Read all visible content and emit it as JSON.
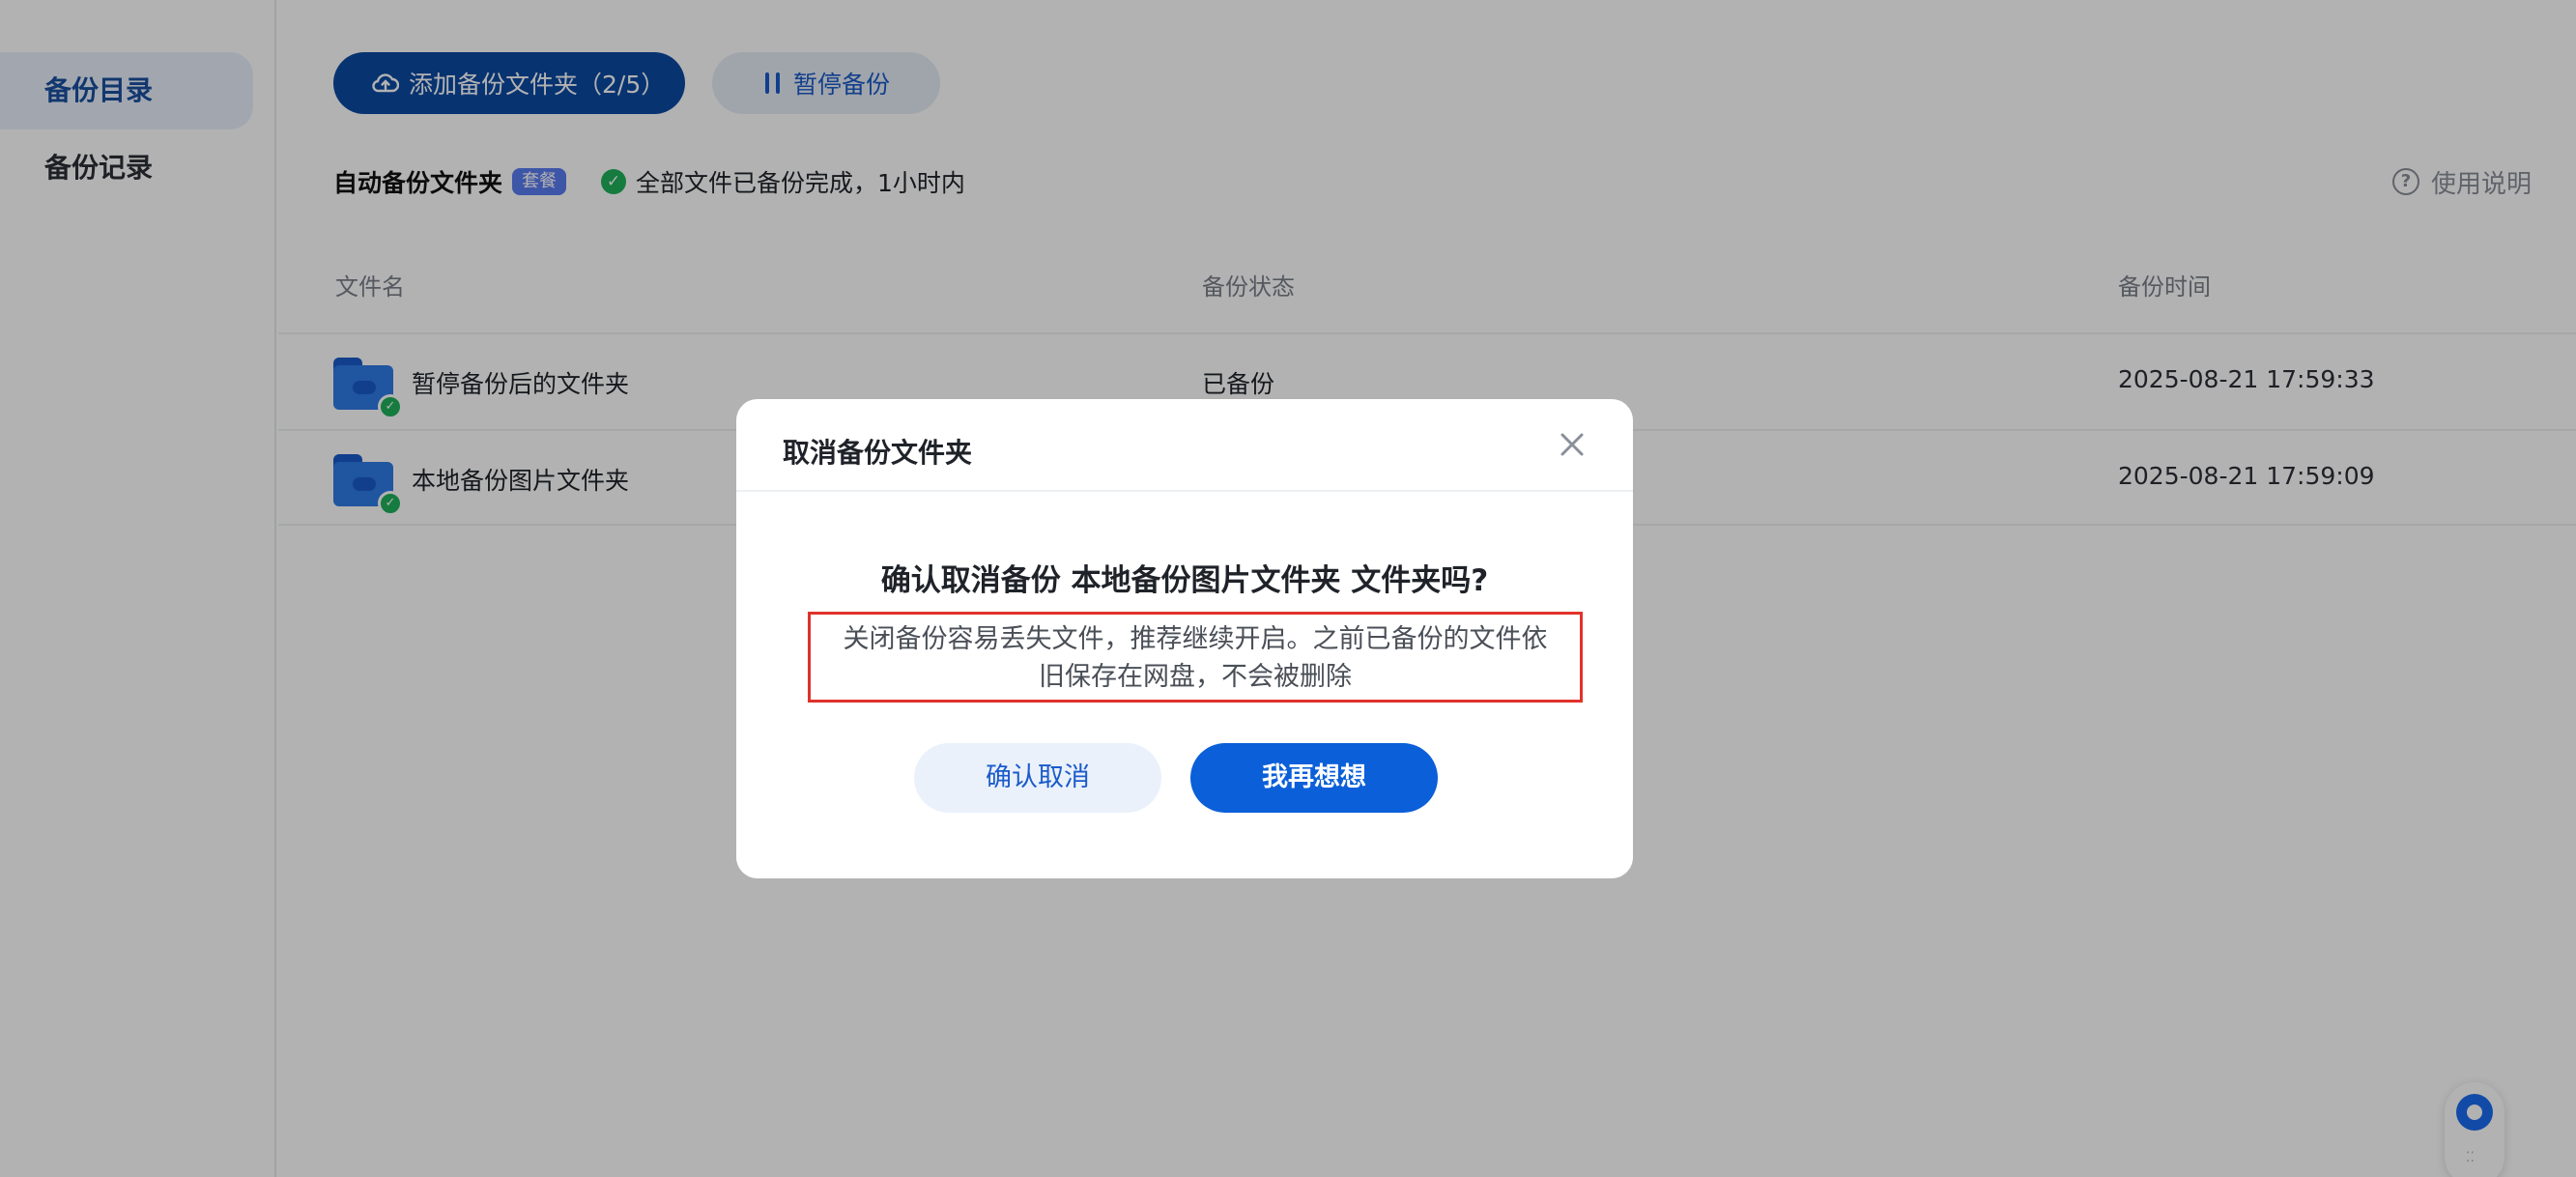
{
  "sidebar": {
    "items": [
      {
        "label": "备份目录",
        "active": true
      },
      {
        "label": "备份记录",
        "active": false
      }
    ]
  },
  "toolbar": {
    "add_label": "添加备份文件夹（2/5）",
    "pause_label": "暂停备份"
  },
  "auto": {
    "title": "自动备份文件夹",
    "badge": "套餐",
    "status": "全部文件已备份完成，1小时内"
  },
  "help": {
    "label": "使用说明"
  },
  "table": {
    "columns": [
      "文件名",
      "备份状态",
      "备份时间"
    ],
    "rows": [
      {
        "name": "暂停备份后的文件夹",
        "status": "已备份",
        "time": "2025-08-21 17:59:33"
      },
      {
        "name": "本地备份图片文件夹",
        "status": "",
        "time": "2025-08-21 17:59:09"
      }
    ]
  },
  "dialog": {
    "title": "取消备份文件夹",
    "question": "确认取消备份 本地备份图片文件夹 文件夹吗?",
    "note_line1": "关闭备份容易丢失文件，推荐继续开启。之前已备份的文件依",
    "note_line2": "旧保存在网盘，不会被删除",
    "confirm_label": "确认取消",
    "rethink_label": "我再想想"
  },
  "colors": {
    "primary": "#0b5fd8",
    "success": "#20b15a",
    "highlight_border": "#e0322b"
  }
}
